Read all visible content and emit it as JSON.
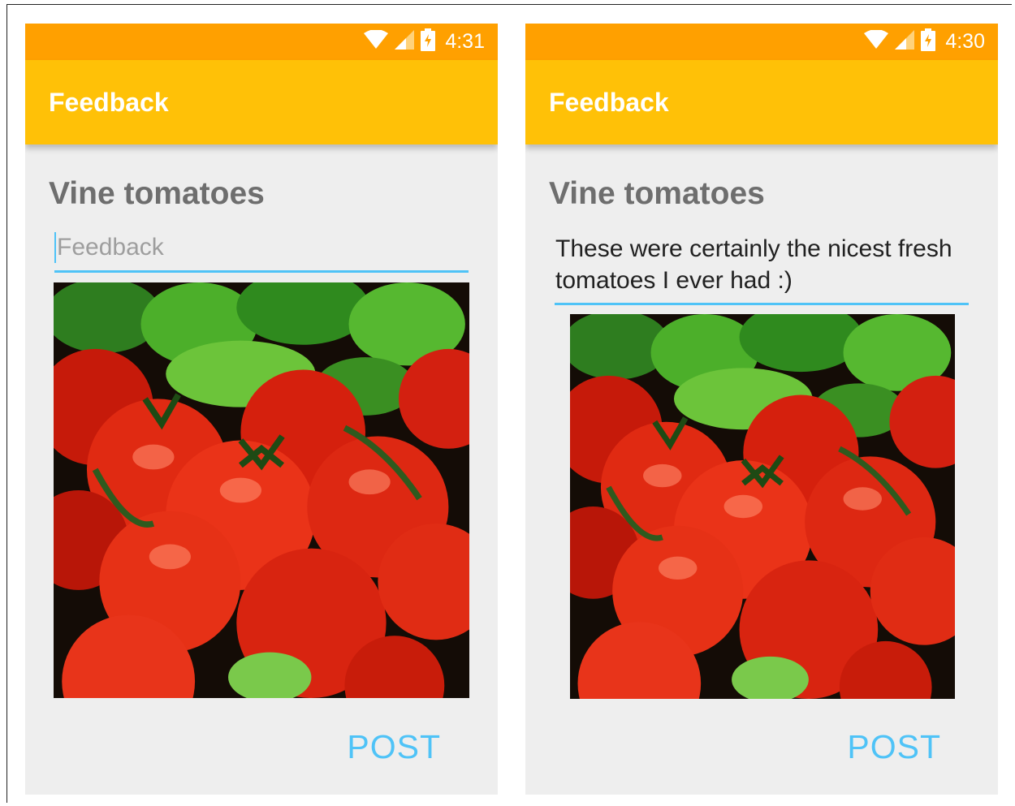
{
  "screens": [
    {
      "status_bar": {
        "time": "4:31"
      },
      "app_bar": {
        "title": "Feedback"
      },
      "product": {
        "title": "Vine tomatoes"
      },
      "feedback": {
        "value": "",
        "placeholder": "Feedback"
      },
      "post_label": "POST"
    },
    {
      "status_bar": {
        "time": "4:30"
      },
      "app_bar": {
        "title": "Feedback"
      },
      "product": {
        "title": "Vine tomatoes"
      },
      "feedback": {
        "value": "These were certainly the nicest fresh tomatoes I ever had :)",
        "placeholder": "Feedback"
      },
      "post_label": "POST"
    }
  ],
  "icons": [
    "wifi-icon",
    "cell-signal-icon",
    "battery-charging-icon"
  ],
  "colors": {
    "status_bar": "#ffa000",
    "app_bar": "#ffc107",
    "accent": "#4fc3f7",
    "background": "#eeeeee",
    "product_title": "#6e6e6e"
  }
}
